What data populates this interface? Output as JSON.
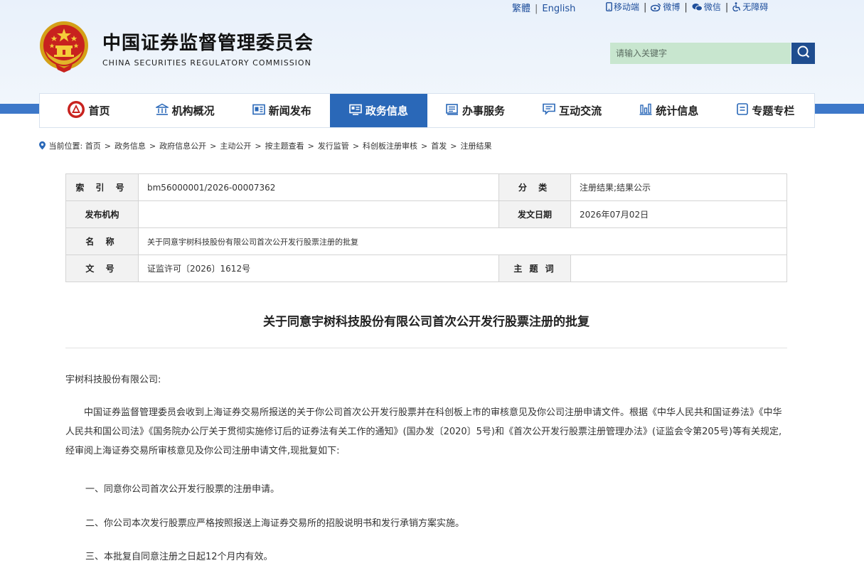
{
  "top_links": {
    "traditional": "繁體",
    "english": "English",
    "mobile": "移动端",
    "weibo": "微博",
    "wechat": "微信",
    "accessibility": "无障碍"
  },
  "header": {
    "org_name_cn": "中国证券监督管理委员会",
    "org_name_en": "CHINA SECURITIES REGULATORY COMMISSION",
    "search_placeholder": "请输入关键字"
  },
  "nav": {
    "items": [
      {
        "label": "首页",
        "icon": "csrc-logo-icon"
      },
      {
        "label": "机构概况",
        "icon": "building-icon"
      },
      {
        "label": "新闻发布",
        "icon": "news-icon"
      },
      {
        "label": "政务信息",
        "icon": "government-info-icon",
        "active": true
      },
      {
        "label": "办事服务",
        "icon": "service-icon"
      },
      {
        "label": "互动交流",
        "icon": "chat-icon"
      },
      {
        "label": "统计信息",
        "icon": "bar-chart-icon"
      },
      {
        "label": "专题专栏",
        "icon": "topic-icon"
      }
    ]
  },
  "breadcrumb": {
    "prefix": "当前位置:",
    "items": [
      "首页",
      "政务信息",
      "政府信息公开",
      "主动公开",
      "按主题查看",
      "发行监管",
      "科创板注册审核",
      "首发",
      "注册结果"
    ]
  },
  "meta_table": {
    "index_label": "索 引 号",
    "index_value": "bm56000001/2026-00007362",
    "category_label": "分 类",
    "category_value": "注册结果;结果公示",
    "issuer_label": "发布机构",
    "issuer_value": "",
    "date_label": "发文日期",
    "date_value": "2026年07月02日",
    "name_label": "名 称",
    "name_value": "关于同意宇树科技股份有限公司首次公开发行股票注册的批复",
    "doc_no_label": "文 号",
    "doc_no_value": "证监许可〔2026〕1612号",
    "subject_label": "主 题 词",
    "subject_value": ""
  },
  "document": {
    "title": "关于同意宇树科技股份有限公司首次公开发行股票注册的批复",
    "addressee": "宇树科技股份有限公司:",
    "paragraph1": "中国证券监督管理委员会收到上海证券交易所报送的关于你公司首次公开发行股票并在科创板上市的审核意见及你公司注册申请文件。根据《中华人民共和国证券法》《中华人民共和国公司法》《国务院办公厅关于贯彻实施修订后的证券法有关工作的通知》(国办发〔2020〕5号)和《首次公开发行股票注册管理办法》(证监会令第205号)等有关规定,经审阅上海证券交易所审核意见及你公司注册申请文件,现批复如下:",
    "item1": "一、同意你公司首次公开发行股票的注册申请。",
    "item2": "二、你公司本次发行股票应严格按照报送上海证券交易所的招股说明书和发行承销方案实施。",
    "item3": "三、本批复自同意注册之日起12个月内有效。"
  },
  "colors": {
    "nav_active": "#2a68b8",
    "nav_band": "#3d78c9",
    "search_bg": "#c8e6cf",
    "search_btn": "#1f4d8f",
    "link_blue": "#1f4f9c"
  }
}
